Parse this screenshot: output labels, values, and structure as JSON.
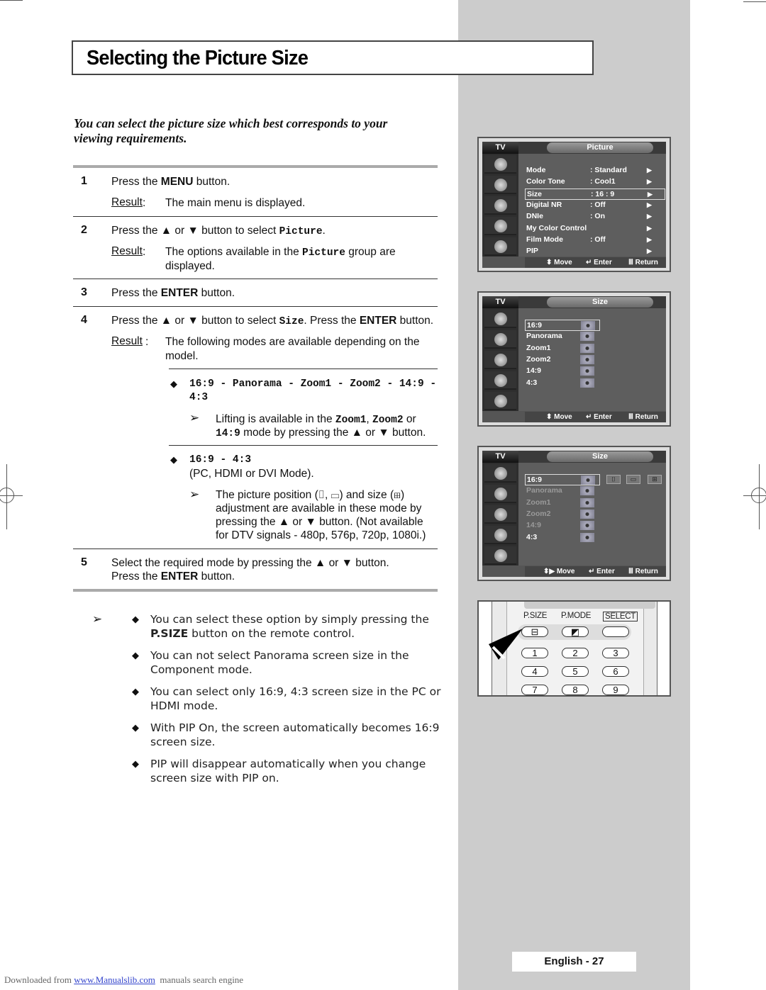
{
  "page": {
    "title": "Selecting the Picture Size",
    "intro": "You can select the picture size which best corresponds to your viewing requirements.",
    "page_label": "English - 27"
  },
  "steps": [
    {
      "num": "1",
      "pre": "Press the ",
      "bold": "MENU",
      "post": " button.",
      "result_label": "Result",
      "result_sep": ":",
      "result": "The main menu is displayed."
    },
    {
      "num": "2",
      "pre": "Press the ▲ or ▼ button to select ",
      "mono": "Picture",
      "post": ".",
      "result_label": "Result",
      "result_sep": ":",
      "result_pre": "The options available in the ",
      "result_mono": "Picture",
      "result_post": " group are",
      "result_line2": "displayed."
    },
    {
      "num": "3",
      "pre": "Press the ",
      "bold": "ENTER",
      "post": " button."
    },
    {
      "num": "4",
      "pre": "Press the ▲ or ▼ button to select ",
      "mono": "Size",
      "mid": ". Press the ",
      "bold": "ENTER",
      "post": " button.",
      "result_label": "Result ",
      "result_sep": ":",
      "result": "The following modes are available depending on the",
      "result_line2": "model.",
      "modes_a": {
        "line1": "16:9 - Panorama - Zoom1 - Zoom2 - 14:9 -",
        "line2": "4:3",
        "tip_pre": "Lifting is available in the ",
        "tip_m1": "Zoom1",
        "tip_sep": ", ",
        "tip_m2": "Zoom2",
        "tip_or": " or",
        "tip_m3": "14:9",
        "tip_post": " mode by pressing the ▲ or ▼ button."
      },
      "modes_b": {
        "line1": "16:9 - 4:3",
        "line2": "(PC, HDMI or DVI Mode).",
        "tip_lines": [
          "The picture position (⌷, ▭) and size (⊞)",
          "adjustment are available in these mode by",
          "pressing the ▲ or ▼ button. (Not available",
          "for DTV signals - 480p, 576p, 720p, 1080i.)"
        ]
      }
    },
    {
      "num": "5",
      "line1": "Select the required mode by pressing the ▲ or ▼ button.",
      "pre": "Press the ",
      "bold": "ENTER",
      "post": " button."
    }
  ],
  "notes": [
    {
      "pre": "You can select these option by simply pressing the",
      "bold": "P.SIZE",
      "post": " button on the remote control."
    },
    {
      "line1": "You can not select Panorama screen size in the",
      "line2": "Component mode."
    },
    {
      "line1": "You can select only 16:9, 4:3 screen size in the PC or",
      "line2": "HDMI mode."
    },
    {
      "line1": "With PIP On, the screen automatically becomes 16:9",
      "line2": "screen size."
    },
    {
      "line1": "PIP will disappear automatically when you change",
      "line2": "screen size with PIP on."
    }
  ],
  "symbols": {
    "arrow": "➢",
    "diamond": "◆",
    "play": "▶"
  },
  "osd_picture": {
    "tv_label": "TV",
    "title": "Picture",
    "rows": [
      {
        "label": "Mode",
        "value": ": Standard"
      },
      {
        "label": "Color Tone",
        "value": ": Cool1"
      },
      {
        "label": "Size",
        "value": ": 16 : 9",
        "selected": true
      },
      {
        "label": "Digital NR",
        "value": ": Off"
      },
      {
        "label": "DNIe",
        "value": ": On"
      },
      {
        "label": "My Color Control",
        "value": ""
      },
      {
        "label": "Film Mode",
        "value": ": Off"
      },
      {
        "label": "PIP",
        "value": ""
      }
    ],
    "footer": {
      "move": "⬍ Move",
      "enter": "↵ Enter",
      "return": "Ⅲ Return"
    }
  },
  "osd_size_a": {
    "tv_label": "TV",
    "title": "Size",
    "rows": [
      "16:9",
      "Panorama",
      "Zoom1",
      "Zoom2",
      "14:9",
      "4:3"
    ],
    "selected": "16:9",
    "footer": {
      "move": "⬍ Move",
      "enter": "↵ Enter",
      "return": "Ⅲ Return"
    }
  },
  "osd_size_b": {
    "tv_label": "TV",
    "title": "Size",
    "rows": [
      "16:9",
      "Panorama",
      "Zoom1",
      "Zoom2",
      "14:9",
      "4:3"
    ],
    "selected": "16:9",
    "enabled": [
      "16:9",
      "4:3"
    ],
    "adjust_icons": [
      "position-vertical",
      "position-horizontal",
      "size"
    ],
    "footer": {
      "move": "⬍▶ Move",
      "enter": "↵ Enter",
      "return": "Ⅲ Return"
    }
  },
  "remote": {
    "labels": [
      "P.SIZE",
      "P.MODE",
      "SELECT"
    ],
    "number_keys": [
      "1",
      "2",
      "3",
      "4",
      "5",
      "6",
      "7",
      "8",
      "9"
    ]
  },
  "footer": {
    "prefix": "Downloaded from ",
    "link": "www.Manualslib.com",
    "suffix": "  manuals search engine"
  }
}
